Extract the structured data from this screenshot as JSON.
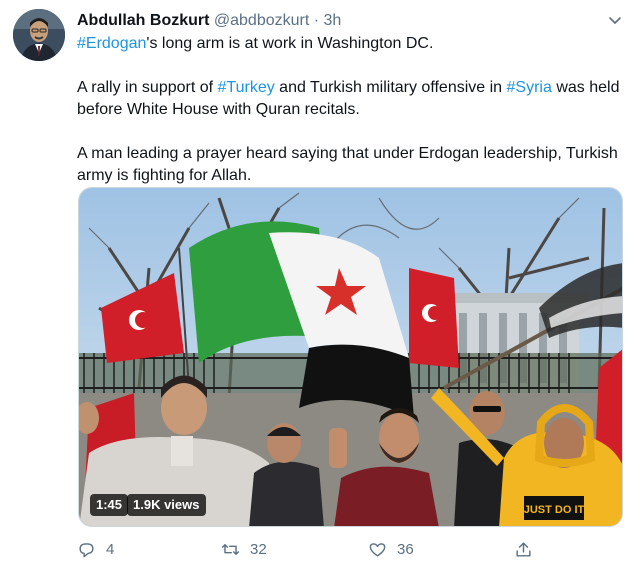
{
  "tweet": {
    "display_name": "Abdullah Bozkurt",
    "handle": "@abdbozkurt",
    "separator": "·",
    "time": "3h",
    "paragraphs": [
      {
        "runs": [
          {
            "text": "#Erdogan",
            "hashtag": true
          },
          {
            "text": "'s long arm is at work in Washington DC.",
            "hashtag": false
          }
        ]
      },
      {
        "runs": [
          {
            "text": "A rally in support of ",
            "hashtag": false
          },
          {
            "text": "#Turkey",
            "hashtag": true
          },
          {
            "text": " and Turkish military offensive in ",
            "hashtag": false
          },
          {
            "text": "#Syria",
            "hashtag": true
          },
          {
            "text": " was held before White House with Quran recitals.",
            "hashtag": false
          }
        ]
      },
      {
        "runs": [
          {
            "text": "A man leading a prayer heard saying that under Erdogan leadership, Turkish army is fighting for Allah.",
            "hashtag": false
          }
        ]
      }
    ],
    "media": {
      "duration": "1:45",
      "views": "1.9K views",
      "shirt_text": "JUST DO IT"
    },
    "actions": {
      "reply_count": "4",
      "retweet_count": "32",
      "like_count": "36"
    }
  },
  "colors": {
    "hashtag": "#1b95e0",
    "secondary_text": "#5b7083",
    "text": "#0f1419"
  },
  "icons": [
    "chevron-down-icon",
    "reply-icon",
    "retweet-icon",
    "like-icon",
    "share-icon"
  ]
}
